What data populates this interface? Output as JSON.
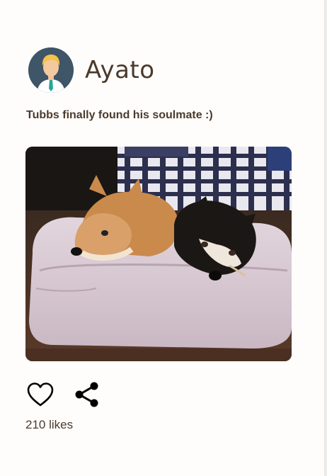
{
  "post": {
    "username": "Ayato",
    "caption": "Tubbs finally found his soulmate :)",
    "likes_text": "210 likes",
    "photo_icon": "two-dogs-on-pet-bed-photo"
  },
  "icons": {
    "like": "heart-icon",
    "share": "share-icon"
  },
  "colors": {
    "text": "#4b3a2b",
    "avatar_bg": "#3f5568"
  }
}
